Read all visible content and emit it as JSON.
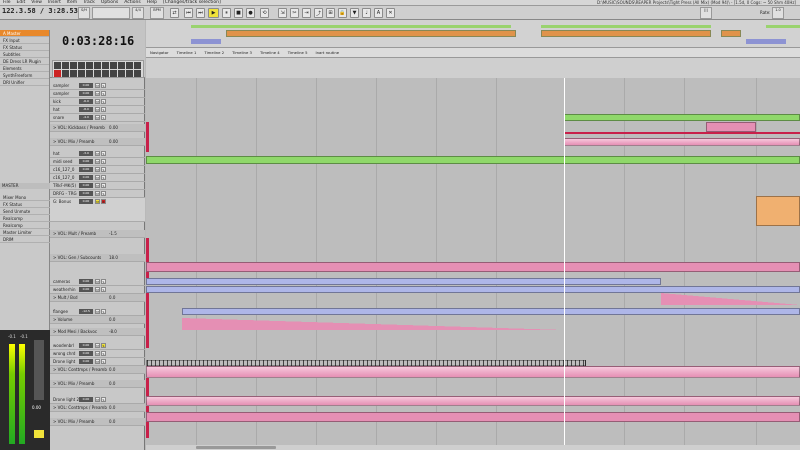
{
  "menu": [
    "File",
    "Edit",
    "View",
    "Insert",
    "Item",
    "Track",
    "Options",
    "Actions",
    "Help"
  ],
  "project_status": "[Changes/track selection]",
  "window_title": "D:\\MUSIC\\SOUNDS\\REAPER Projects\\Tight Press (All Mix) (Mod 94)\\ - [1.5d, 0 Cogs: ~ 50 Shm 40Hz]",
  "transport": {
    "position": "122.3.58 / 3:28.535",
    "bpm_label": "BPM",
    "bpm": "123",
    "time_sig": "4/4",
    "rate_label": "Rate:",
    "rate": "1.0"
  },
  "big_time": "0:03:28:16",
  "markers": [
    "Navigator",
    "Timeline 1",
    "Timeline 2",
    "Timeline 3",
    "Timeline 4",
    "Timeline 5",
    "Inart routine"
  ],
  "sidebar": {
    "items": [
      {
        "label": "A Master",
        "selected": true
      },
      {
        "label": "FX Input"
      },
      {
        "label": "FX Status"
      },
      {
        "label": "Subtitles"
      },
      {
        "label": "DE Dress LR Plugin"
      },
      {
        "label": "Elements"
      },
      {
        "label": "SynthFreeform"
      },
      {
        "label": "DRI Unifier"
      }
    ],
    "master_label": "MASTER",
    "master_items": [
      {
        "label": "Mixer Mono"
      },
      {
        "label": "FX Status"
      },
      {
        "label": "Send Unmute"
      },
      {
        "label": "Realcomp"
      },
      {
        "label": "Realcomp"
      },
      {
        "label": "Master Limiter"
      },
      {
        "label": "DRIM"
      }
    ]
  },
  "tracks": [
    {
      "name": "sampler",
      "vol": "0.00"
    },
    {
      "name": "sampler",
      "vol": "0.00"
    },
    {
      "name": "kick",
      "vol": "-6.0"
    },
    {
      "name": "hat",
      "vol": "-8.0"
    },
    {
      "name": "snare",
      "vol": "-4.0"
    },
    {
      "name": "> VOL: Kickbass / Preamb",
      "vol": "0.00"
    },
    {
      "name": "> VOL: Mix / Preamb",
      "vol": "0.00"
    },
    {
      "name": "hat",
      "vol": "-3.0"
    },
    {
      "name": "midi seed",
      "vol": "0.00"
    },
    {
      "name": "c16_127_0",
      "vol": "0.00"
    },
    {
      "name": "c16_127_0",
      "vol": "0.00"
    },
    {
      "name": "TRkF-MK(5)",
      "vol": "0.00"
    },
    {
      "name": "DRFG - TRG",
      "vol": "0.00"
    },
    {
      "name": "G: Bonus",
      "vol": "0.00"
    },
    {
      "name": "> VOL: Mult / Preamb",
      "vol": "-1.5"
    },
    {
      "name": "> VOL: Gen / Subcounts",
      "vol": "18.0"
    },
    {
      "name": "cameras",
      "vol": "0.00"
    },
    {
      "name": "weatherhin",
      "vol": "0.00"
    },
    {
      "name": "> Mult / Bsd",
      "vol": "0.0"
    },
    {
      "name": "flangee",
      "vol": "-12.5"
    },
    {
      "name": "> Volume",
      "vol": "0.0"
    },
    {
      "name": "> Mod Mesi / Backvoc",
      "vol": "-8.0"
    },
    {
      "name": "woodenbrl",
      "vol": "0.00"
    },
    {
      "name": "wrong chrd",
      "vol": "0.00"
    },
    {
      "name": "Drone light",
      "vol": "0.00"
    },
    {
      "name": "> VOL: Conttmps / Preamb",
      "vol": "0.0"
    },
    {
      "name": "> VOL: Mix / Preamb",
      "vol": "0.0"
    },
    {
      "name": "Drone light 2",
      "vol": "0.00"
    },
    {
      "name": "> VOL: Conttmps / Preamb",
      "vol": "0.0"
    },
    {
      "name": "> VOL: Mix / Preamb",
      "vol": "0.0"
    }
  ],
  "meters": {
    "left": "-0.1",
    "right": "-0.1",
    "master": "0.00"
  },
  "colors": {
    "accent": "#e8882a",
    "play": "#f0e23a",
    "clip_green": "#8fd86a",
    "clip_pink": "#e58fb4",
    "clip_blue": "#aeb6e8",
    "clip_orange": "#f0b070"
  }
}
